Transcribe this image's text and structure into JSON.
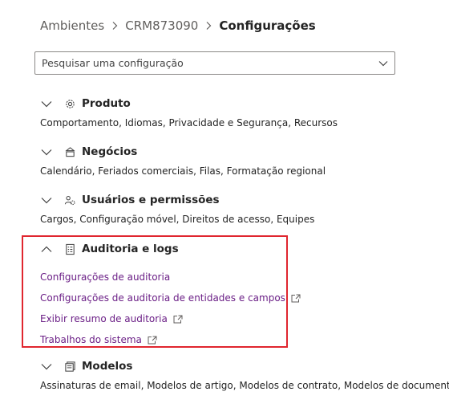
{
  "breadcrumb": {
    "items": [
      "Ambientes",
      "CRM873090"
    ],
    "current": "Configurações"
  },
  "search": {
    "placeholder": "Pesquisar uma configuração"
  },
  "sections": [
    {
      "title": "Produto",
      "icon": "gear-icon",
      "expanded": false,
      "description": "Comportamento, Idiomas, Privacidade e Segurança, Recursos"
    },
    {
      "title": "Negócios",
      "icon": "business-icon",
      "expanded": false,
      "description": "Calendário, Feriados comerciais, Filas, Formatação regional"
    },
    {
      "title": "Usuários e permissões",
      "icon": "people-settings-icon",
      "expanded": false,
      "description": "Cargos, Configuração móvel, Direitos de acesso, Equipes"
    },
    {
      "title": "Auditoria e logs",
      "icon": "audit-log-icon",
      "expanded": true,
      "links": [
        {
          "label": "Configurações de auditoria",
          "external": false
        },
        {
          "label": "Configurações de auditoria de entidades e campos",
          "external": true
        },
        {
          "label": "Exibir resumo de auditoria",
          "external": true
        },
        {
          "label": "Trabalhos do sistema",
          "external": true
        }
      ]
    },
    {
      "title": "Modelos",
      "icon": "templates-icon",
      "expanded": false,
      "description": "Assinaturas de email, Modelos de artigo, Modelos de contrato, Modelos de documento"
    }
  ],
  "colors": {
    "link": "#6b1f86",
    "highlight": "#e0262f",
    "text": "#242424"
  }
}
